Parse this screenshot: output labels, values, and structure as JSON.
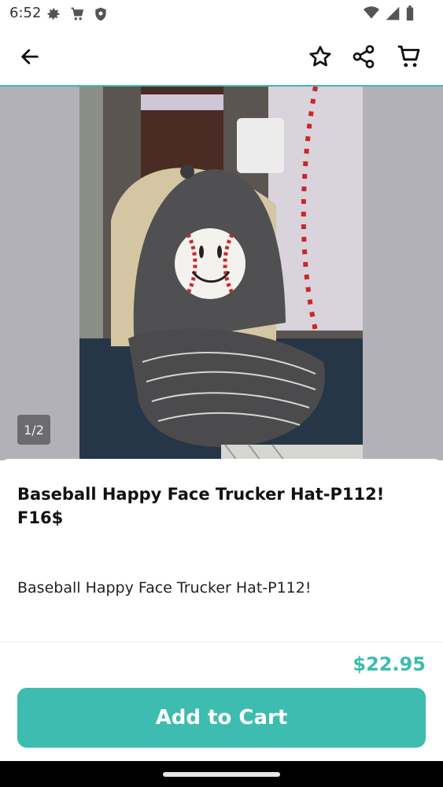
{
  "status_bar": {
    "time": "6:52",
    "left_icons": [
      "gear-icon",
      "cart-icon",
      "shield-icon"
    ],
    "right_icons": [
      "wifi-icon",
      "signal-icon",
      "battery-icon"
    ]
  },
  "top_bar": {
    "icons": [
      "back-arrow-icon",
      "star-icon",
      "share-icon",
      "cart-icon"
    ]
  },
  "gallery": {
    "page_indicator": "1/2"
  },
  "product": {
    "title": "Baseball Happy Face Trucker Hat-P112! F16$",
    "description": "Baseball Happy Face Trucker Hat-P112!",
    "price": "$22.95"
  },
  "actions": {
    "add_to_cart_label": "Add to Cart"
  },
  "colors": {
    "accent": "#3dbcaf"
  }
}
